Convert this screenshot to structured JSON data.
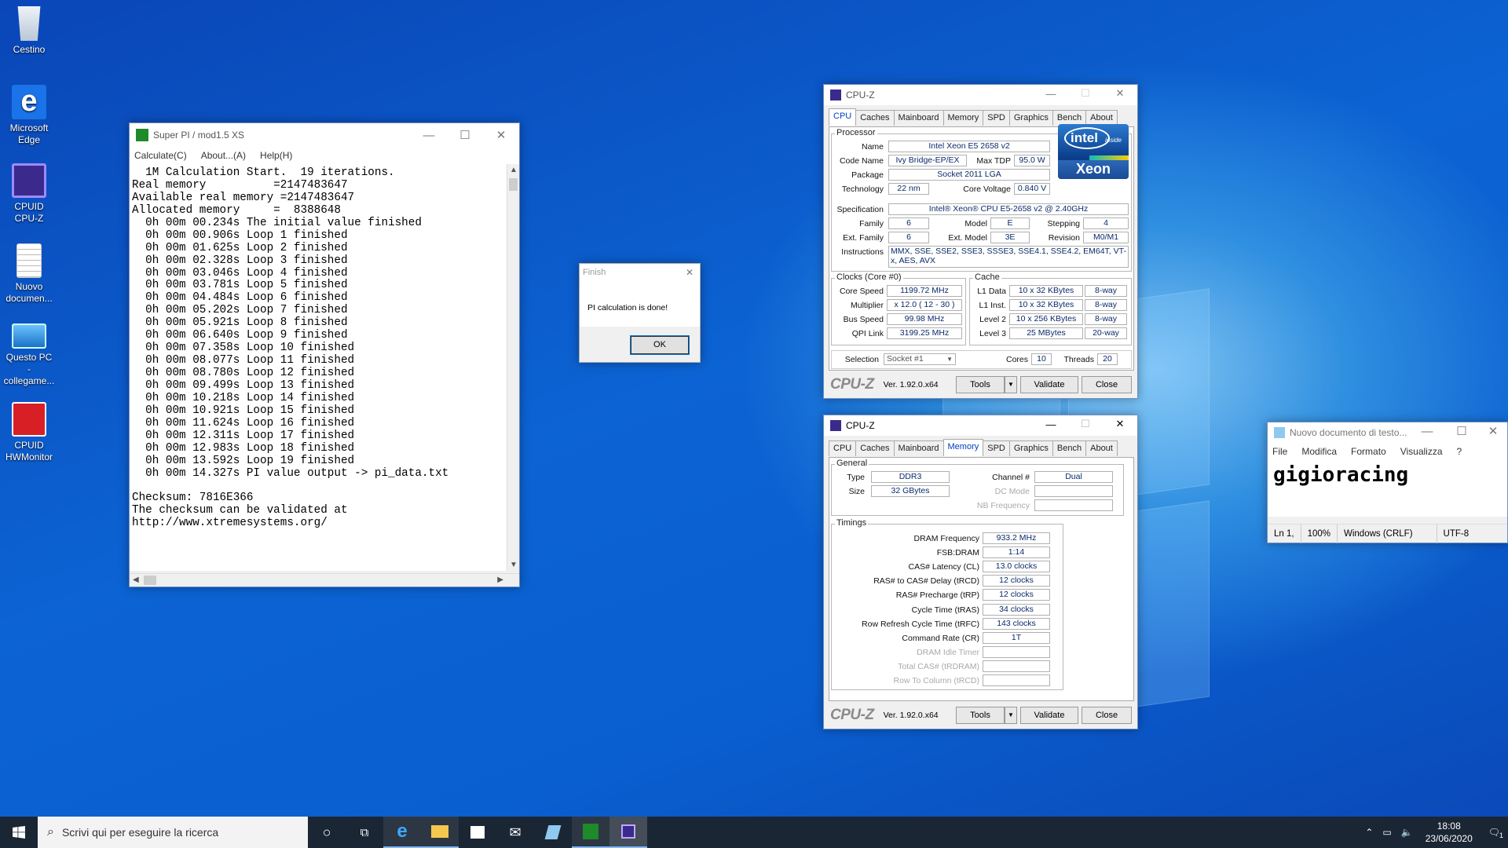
{
  "desktop": {
    "icons": [
      {
        "label": "Cestino",
        "icon": "recycle-bin-icon"
      },
      {
        "label": "Microsoft Edge",
        "icon": "edge-icon"
      },
      {
        "label": "CPUID CPU-Z",
        "icon": "cpuz-icon"
      },
      {
        "label": "Nuovo documen...",
        "icon": "text-document-icon"
      },
      {
        "label": "Questo PC - collegame...",
        "icon": "computer-icon"
      },
      {
        "label": "CPUID HWMonitor",
        "icon": "hwmonitor-icon"
      }
    ]
  },
  "superpi": {
    "title": "Super PI / mod1.5 XS",
    "menu": [
      "Calculate(C)",
      "About...(A)",
      "Help(H)"
    ],
    "lines": [
      "  1M Calculation Start.  19 iterations.",
      "Real memory          =2147483647",
      "Available real memory =2147483647",
      "Allocated memory     =  8388648",
      "  0h 00m 00.234s The initial value finished",
      "  0h 00m 00.906s Loop 1 finished",
      "  0h 00m 01.625s Loop 2 finished",
      "  0h 00m 02.328s Loop 3 finished",
      "  0h 00m 03.046s Loop 4 finished",
      "  0h 00m 03.781s Loop 5 finished",
      "  0h 00m 04.484s Loop 6 finished",
      "  0h 00m 05.202s Loop 7 finished",
      "  0h 00m 05.921s Loop 8 finished",
      "  0h 00m 06.640s Loop 9 finished",
      "  0h 00m 07.358s Loop 10 finished",
      "  0h 00m 08.077s Loop 11 finished",
      "  0h 00m 08.780s Loop 12 finished",
      "  0h 00m 09.499s Loop 13 finished",
      "  0h 00m 10.218s Loop 14 finished",
      "  0h 00m 10.921s Loop 15 finished",
      "  0h 00m 11.624s Loop 16 finished",
      "  0h 00m 12.311s Loop 17 finished",
      "  0h 00m 12.983s Loop 18 finished",
      "  0h 00m 13.592s Loop 19 finished",
      "  0h 00m 14.327s PI value output -> pi_data.txt",
      "",
      "Checksum: 7816E366",
      "The checksum can be validated at",
      "http://www.xtremesystems.org/"
    ]
  },
  "finish": {
    "title": "Finish",
    "message": "PI calculation is done!",
    "ok": "OK"
  },
  "cpuz_tabs": [
    "CPU",
    "Caches",
    "Mainboard",
    "Memory",
    "SPD",
    "Graphics",
    "Bench",
    "About"
  ],
  "cpuz1": {
    "title": "CPU-Z",
    "processor": {
      "group": "Processor",
      "name_l": "Name",
      "name": "Intel Xeon E5 2658 v2",
      "code_l": "Code Name",
      "code": "Ivy Bridge-EP/EX",
      "tdp_l": "Max TDP",
      "tdp": "95.0 W",
      "pkg_l": "Package",
      "pkg": "Socket 2011 LGA",
      "tech_l": "Technology",
      "tech": "22 nm",
      "volt_l": "Core Voltage",
      "volt": "0.840 V",
      "spec_l": "Specification",
      "spec": "Intel® Xeon® CPU E5-2658 v2 @ 2.40GHz",
      "fam_l": "Family",
      "fam": "6",
      "model_l": "Model",
      "model": "E",
      "step_l": "Stepping",
      "step": "4",
      "efam_l": "Ext. Family",
      "efam": "6",
      "emod_l": "Ext. Model",
      "emod": "3E",
      "rev_l": "Revision",
      "rev": "M0/M1",
      "ins_l": "Instructions",
      "ins": "MMX, SSE, SSE2, SSE3, SSSE3, SSE4.1, SSE4.2, EM64T, VT-x, AES, AVX"
    },
    "logo": {
      "brand": "intel",
      "inside": "inside",
      "line": "Xeon"
    },
    "clocks": {
      "group": "Clocks (Core #0)",
      "cs_l": "Core Speed",
      "cs": "1199.72 MHz",
      "mul_l": "Multiplier",
      "mul": "x 12.0 ( 12 - 30 )",
      "bus_l": "Bus Speed",
      "bus": "99.98 MHz",
      "qpi_l": "QPI Link",
      "qpi": "3199.25 MHz"
    },
    "cache": {
      "group": "Cache",
      "l1d_l": "L1 Data",
      "l1d": "10 x 32 KBytes",
      "l1d_w": "8-way",
      "l1i_l": "L1 Inst.",
      "l1i": "10 x 32 KBytes",
      "l1i_w": "8-way",
      "l2_l": "Level 2",
      "l2": "10 x 256 KBytes",
      "l2_w": "8-way",
      "l3_l": "Level 3",
      "l3": "25 MBytes",
      "l3_w": "20-way"
    },
    "sel_l": "Selection",
    "sel": "Socket #1",
    "cores_l": "Cores",
    "cores": "10",
    "threads_l": "Threads",
    "threads": "20",
    "brand": "CPU-Z",
    "version": "Ver. 1.92.0.x64",
    "tools": "Tools",
    "validate": "Validate",
    "close": "Close"
  },
  "cpuz2": {
    "title": "CPU-Z",
    "general": {
      "group": "General",
      "type_l": "Type",
      "type": "DDR3",
      "size_l": "Size",
      "size": "32 GBytes",
      "ch_l": "Channel #",
      "ch": "Dual",
      "dc_l": "DC Mode",
      "nb_l": "NB Frequency"
    },
    "timings": {
      "group": "Timings",
      "rows": [
        {
          "l": "DRAM Frequency",
          "v": "933.2 MHz"
        },
        {
          "l": "FSB:DRAM",
          "v": "1:14"
        },
        {
          "l": "CAS# Latency (CL)",
          "v": "13.0 clocks"
        },
        {
          "l": "RAS# to CAS# Delay (tRCD)",
          "v": "12 clocks"
        },
        {
          "l": "RAS# Precharge (tRP)",
          "v": "12 clocks"
        },
        {
          "l": "Cycle Time (tRAS)",
          "v": "34 clocks"
        },
        {
          "l": "Row Refresh Cycle Time (tRFC)",
          "v": "143 clocks"
        },
        {
          "l": "Command Rate (CR)",
          "v": "1T"
        },
        {
          "l": "DRAM Idle Timer",
          "v": ""
        },
        {
          "l": "Total CAS# (tRDRAM)",
          "v": ""
        },
        {
          "l": "Row To Column (tRCD)",
          "v": ""
        }
      ]
    },
    "brand": "CPU-Z",
    "version": "Ver. 1.92.0.x64",
    "tools": "Tools",
    "validate": "Validate",
    "close": "Close"
  },
  "notepad": {
    "title": "Nuovo documento di testo...",
    "menu": [
      "File",
      "Modifica",
      "Formato",
      "Visualizza",
      "?"
    ],
    "text": "gigioracing",
    "status": [
      "Ln 1,",
      "100%",
      "Windows (CRLF)",
      "UTF-8"
    ]
  },
  "taskbar": {
    "search_placeholder": "Scrivi qui per eseguire la ricerca",
    "time": "18:08",
    "date": "23/06/2020",
    "notif": "1"
  }
}
